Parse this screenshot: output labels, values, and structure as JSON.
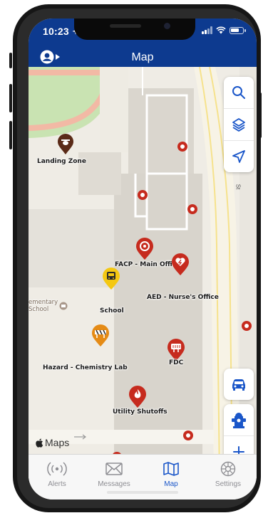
{
  "status_bar": {
    "time": "10:23",
    "battery_level": 0.75
  },
  "nav": {
    "title": "Map"
  },
  "map": {
    "attribution": "Maps",
    "poi_label": "ementary\nSchool",
    "markers": [
      {
        "label": "Landing Zone",
        "icon": "helicopter-icon",
        "color": "#5a2a17"
      },
      {
        "label": "FACP - Main Office",
        "icon": "alarm-panel-icon",
        "color": "#c62b1e"
      },
      {
        "label": "AED - Nurse's Office",
        "icon": "heart-defibrillator-icon",
        "color": "#c62b1e"
      },
      {
        "label": "School",
        "icon": "school-bus-icon",
        "color": "#f4c812"
      },
      {
        "label": "Hazard - Chemistry Lab",
        "icon": "barricade-icon",
        "color": "#e58b16"
      },
      {
        "label": "FDC",
        "icon": "fire-dept-connection-icon",
        "color": "#c62b1e"
      },
      {
        "label": "Utility Shutoffs",
        "icon": "flame-icon",
        "color": "#c62b1e"
      }
    ]
  },
  "controls": {
    "top": [
      "search-icon",
      "layers-icon",
      "location-arrow-icon"
    ],
    "bottom": [
      "car-icon",
      "hydrant-icon",
      "plus-icon"
    ]
  },
  "tabs": [
    {
      "label": "Alerts",
      "icon": "broadcast-icon"
    },
    {
      "label": "Messages",
      "icon": "envelope-icon"
    },
    {
      "label": "Map",
      "icon": "map-icon",
      "active": true
    },
    {
      "label": "Settings",
      "icon": "gear-icon"
    }
  ],
  "colors": {
    "nav_bar": "#0d3a8f",
    "accent": "#1a56c9",
    "alert_red": "#c62b1e",
    "map_bg": "#efece5",
    "road": "#f7f3e6",
    "grass": "#c9e3b2"
  }
}
